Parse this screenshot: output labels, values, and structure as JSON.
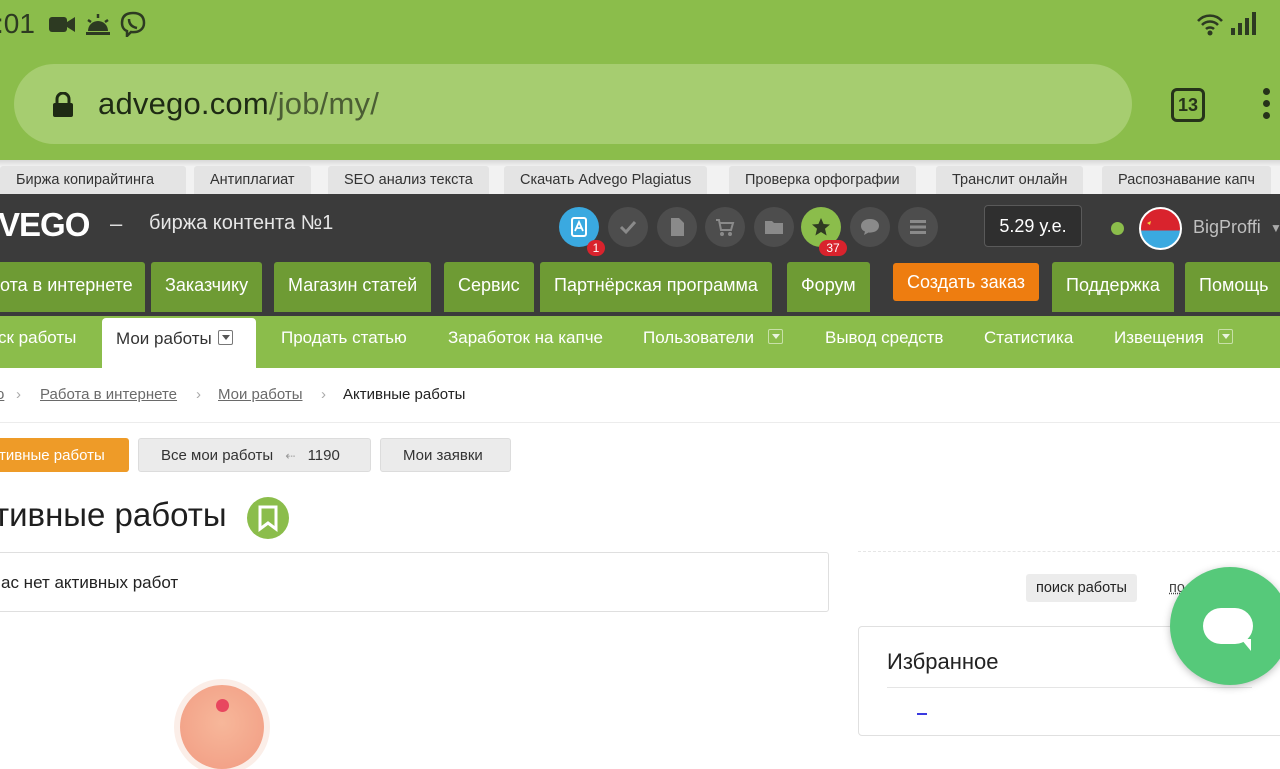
{
  "status_bar": {
    "time": ":01",
    "icons": [
      "video-call-icon",
      "weather-icon",
      "viber-icon",
      "wifi-icon",
      "signal-icon"
    ]
  },
  "browser": {
    "url_host": "advego.com",
    "url_path": "/job/my/",
    "tab_count": "13"
  },
  "top_links": [
    "Биржа копирайтинга",
    "Антиплагиат",
    "SEO анализ текста",
    "Скачать Advego Plagiatus",
    "Проверка орфографии",
    "Транслит онлайн",
    "Распознавание капч"
  ],
  "header": {
    "logo": "VEGO",
    "dash": "–",
    "tagline": "биржа контента №1",
    "badges": {
      "articles": "1",
      "favorites": "37"
    },
    "balance": "5.29 у.е.",
    "username": "BigProffi"
  },
  "main_nav": [
    "ота в интернете",
    "Заказчику",
    "Магазин статей",
    "Сервис",
    "Партнёрская программа",
    "Форум",
    "Создать заказ",
    "Поддержка",
    "Помощь"
  ],
  "sub_nav": [
    "ск работы",
    "Мои работы",
    "Продать статью",
    "Заработок на капче",
    "Пользователи",
    "Вывод средств",
    "Статистика",
    "Извещения"
  ],
  "breadcrumb": {
    "first": "о",
    "sep": "›",
    "work": "Работа в интернете",
    "my_work": "Мои работы",
    "current": "Активные работы"
  },
  "page_buttons": {
    "active": "тивные работы",
    "all": "Все мои работы",
    "all_count": "1190",
    "requests": "Мои заявки"
  },
  "page": {
    "title": "тивные работы",
    "empty_text": "ас нет активных работ"
  },
  "sidebar": {
    "search_chip": "поиск работы",
    "more_chip": "по",
    "favorites_title": "Избранное"
  },
  "colors": {
    "browser_green": "#8bbd4b",
    "nav_green": "#6e9b34",
    "header_dark": "#3b3b3b",
    "orange": "#ee7d10",
    "chat_green": "#56c97a",
    "badge_red": "#d9232d"
  }
}
